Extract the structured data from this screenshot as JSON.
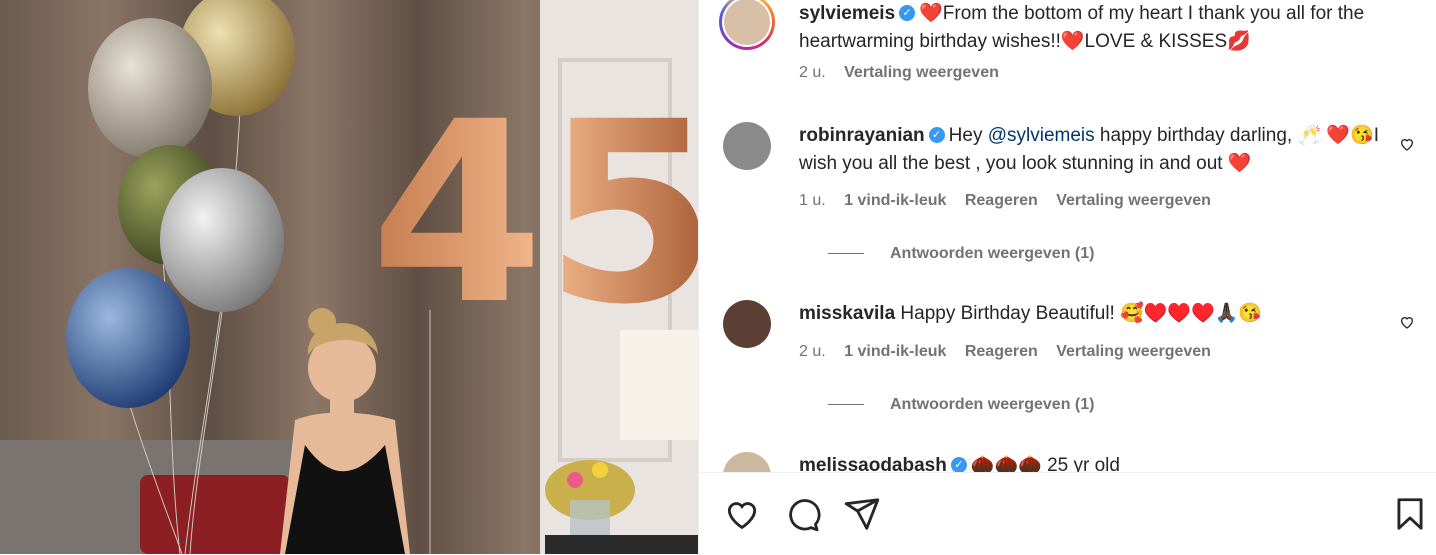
{
  "post": {
    "author": "sylviemeis",
    "caption": "❤️From the bottom of my heart I thank you all for the heartwarming birthday wishes!!❤️LOVE & KISSES💋",
    "age": "2 u.",
    "translate": "Vertaling weergeven",
    "image_numbers": "45"
  },
  "comments": [
    {
      "user": "robinrayanian",
      "verified": true,
      "text_before": "Hey ",
      "mention": "@sylviemeis",
      "text_after": " happy birthday darling, 🥂 ❤️😘I wish you all the best , you look stunning in and out ❤️",
      "age": "1 u.",
      "likes": "1 vind-ik-leuk",
      "reply": "Reageren",
      "translate": "Vertaling weergeven",
      "view_replies": "Antwoorden weergeven (1)"
    },
    {
      "user": "misskavila",
      "verified": false,
      "text": "Happy Birthday Beautiful! 🥰♥️♥️♥️🙏🏿😘",
      "age": "2 u.",
      "likes": "1 vind-ik-leuk",
      "reply": "Reageren",
      "translate": "Vertaling weergeven",
      "view_replies": "Antwoorden weergeven (1)"
    },
    {
      "user": "melissaodabash",
      "verified": true,
      "text": "🌰🌰🌰 25 yr old"
    }
  ],
  "actions": {
    "like": "heart-icon",
    "comment": "comment-icon",
    "share": "share-icon",
    "save": "bookmark-icon"
  }
}
